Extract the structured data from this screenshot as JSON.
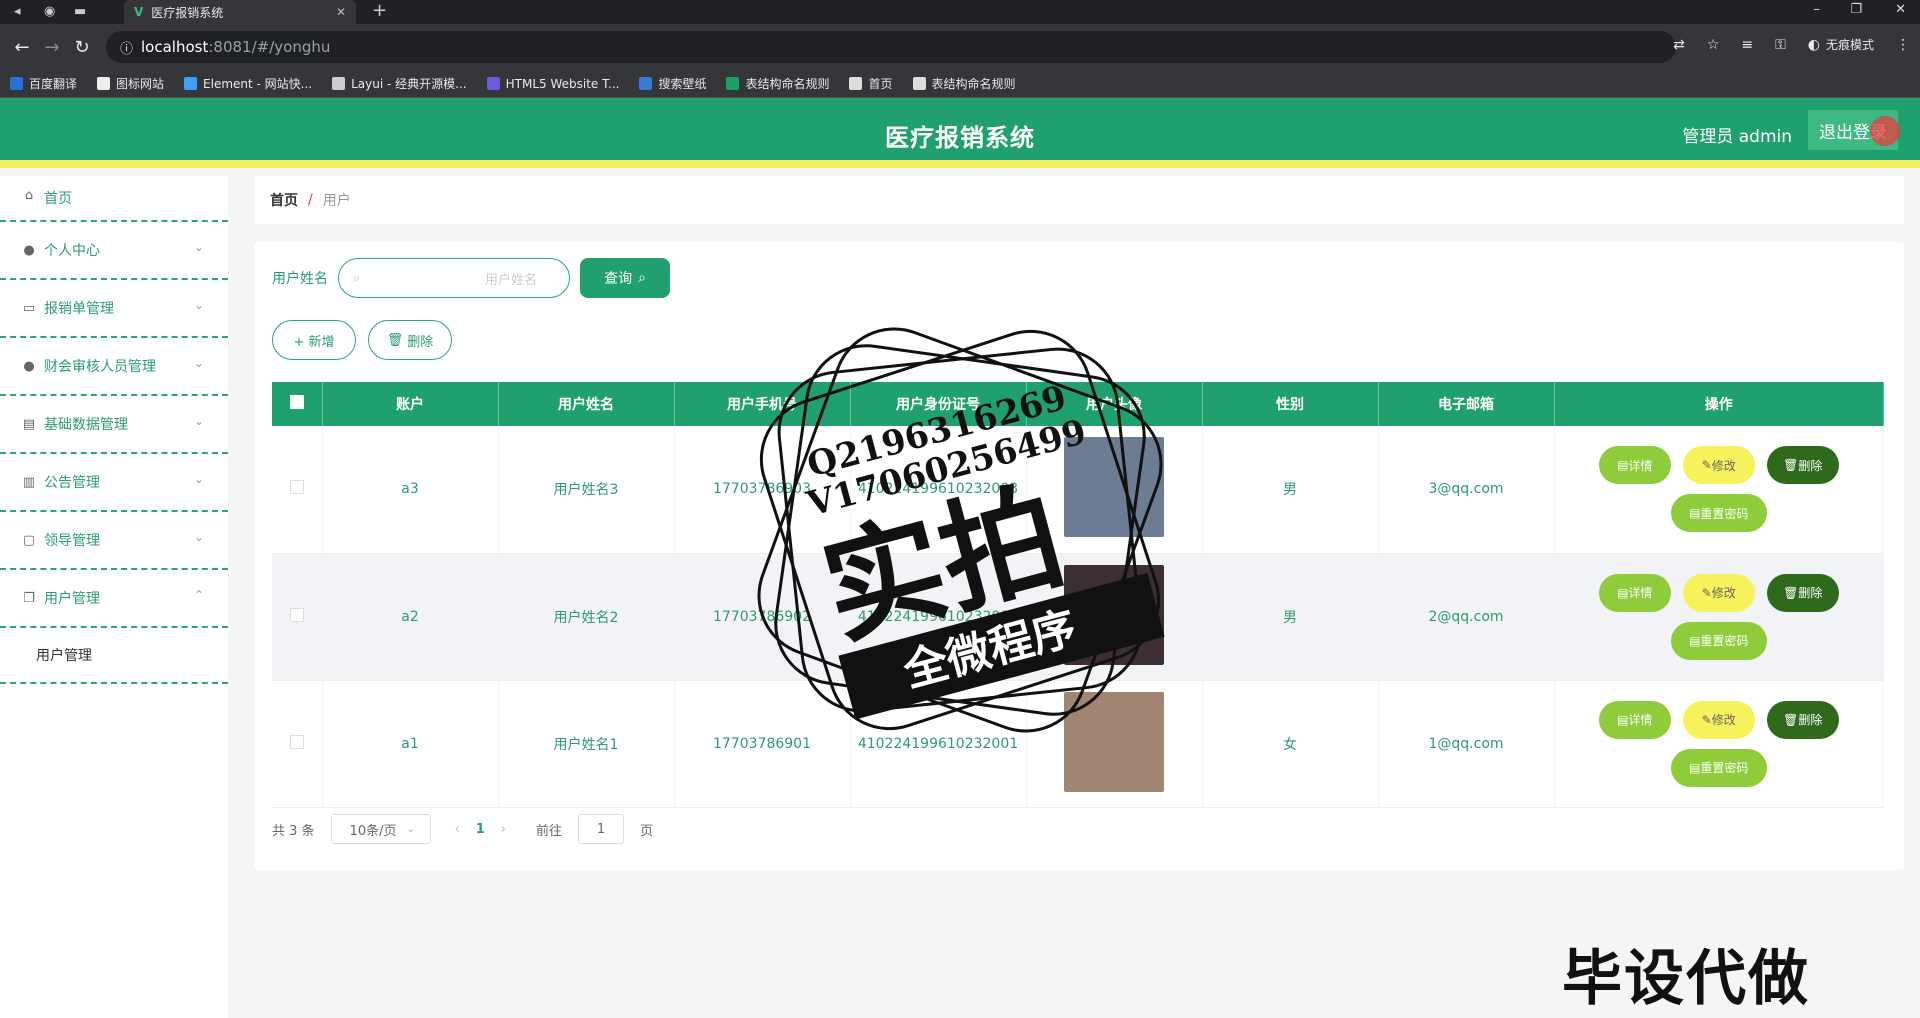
{
  "browser": {
    "tab_title": "医疗报销系统",
    "url_host": "localhost",
    "url_rest": ":8081/#/yonghu",
    "incognito_label": "无痕模式",
    "bookmarks": [
      {
        "label": "百度翻译",
        "color": "#2a6fdb"
      },
      {
        "label": "图标网站",
        "color": "#eeeeee"
      },
      {
        "label": "Element - 网站快...",
        "color": "#409eff"
      },
      {
        "label": "Layui - 经典开源模...",
        "color": "#cccccc"
      },
      {
        "label": "HTML5 Website T...",
        "color": "#6b5bd6"
      },
      {
        "label": "搜索壁纸",
        "color": "#3a7bd5"
      },
      {
        "label": "表结构命名规则",
        "color": "#1aa260"
      },
      {
        "label": "首页",
        "color": "#dddddd"
      },
      {
        "label": "表结构命名规则",
        "color": "#dddddd"
      }
    ]
  },
  "header": {
    "title": "医疗报销系统",
    "admin_label": "管理员 admin",
    "logout_label": "退出登录"
  },
  "sidebar": {
    "items": [
      {
        "label": "首页",
        "icon": "home-icon"
      },
      {
        "label": "个人中心",
        "icon": "user-icon"
      },
      {
        "label": "报销单管理",
        "icon": "ticket-icon"
      },
      {
        "label": "财会审核人员管理",
        "icon": "user-icon"
      },
      {
        "label": "基础数据管理",
        "icon": "chart-icon"
      },
      {
        "label": "公告管理",
        "icon": "clipboard-icon"
      },
      {
        "label": "领导管理",
        "icon": "message-icon"
      },
      {
        "label": "用户管理",
        "icon": "copy-icon"
      }
    ],
    "sub_item": "用户管理"
  },
  "breadcrumb": {
    "home": "首页",
    "sep": "/",
    "current": "用户"
  },
  "search": {
    "label": "用户姓名",
    "placeholder": "用户姓名",
    "button": "查询"
  },
  "toolbar": {
    "add": "+ 新增",
    "delete": "删除"
  },
  "table": {
    "columns": [
      "账户",
      "用户姓名",
      "用户手机号",
      "用户身份证号",
      "用户头像",
      "性别",
      "电子邮箱",
      "操作"
    ],
    "rows": [
      {
        "account": "a3",
        "name": "用户姓名3",
        "phone": "17703786903",
        "idcard": "410224199610232003",
        "gender": "男",
        "email": "3@qq.com",
        "avatar_color": "#6c7d93"
      },
      {
        "account": "a2",
        "name": "用户姓名2",
        "phone": "17703786902",
        "idcard": "410224199610232002",
        "gender": "男",
        "email": "2@qq.com",
        "avatar_color": "#3b2f34"
      },
      {
        "account": "a1",
        "name": "用户姓名1",
        "phone": "17703786901",
        "idcard": "410224199610232001",
        "gender": "女",
        "email": "1@qq.com",
        "avatar_color": "#a08672"
      }
    ],
    "actions": {
      "detail": "详情",
      "edit": "修改",
      "delete": "删除",
      "reset": "重置密码"
    }
  },
  "pagination": {
    "total": "共 3 条",
    "page_size": "10条/页",
    "current": "1",
    "goto": "前往",
    "goto_value": "1",
    "page_unit": "页"
  },
  "watermark": {
    "qq": "Q2196316269",
    "vx": "V17060256499",
    "big": "实拍",
    "ribbon": "全微程序",
    "corner": "毕设代做"
  }
}
